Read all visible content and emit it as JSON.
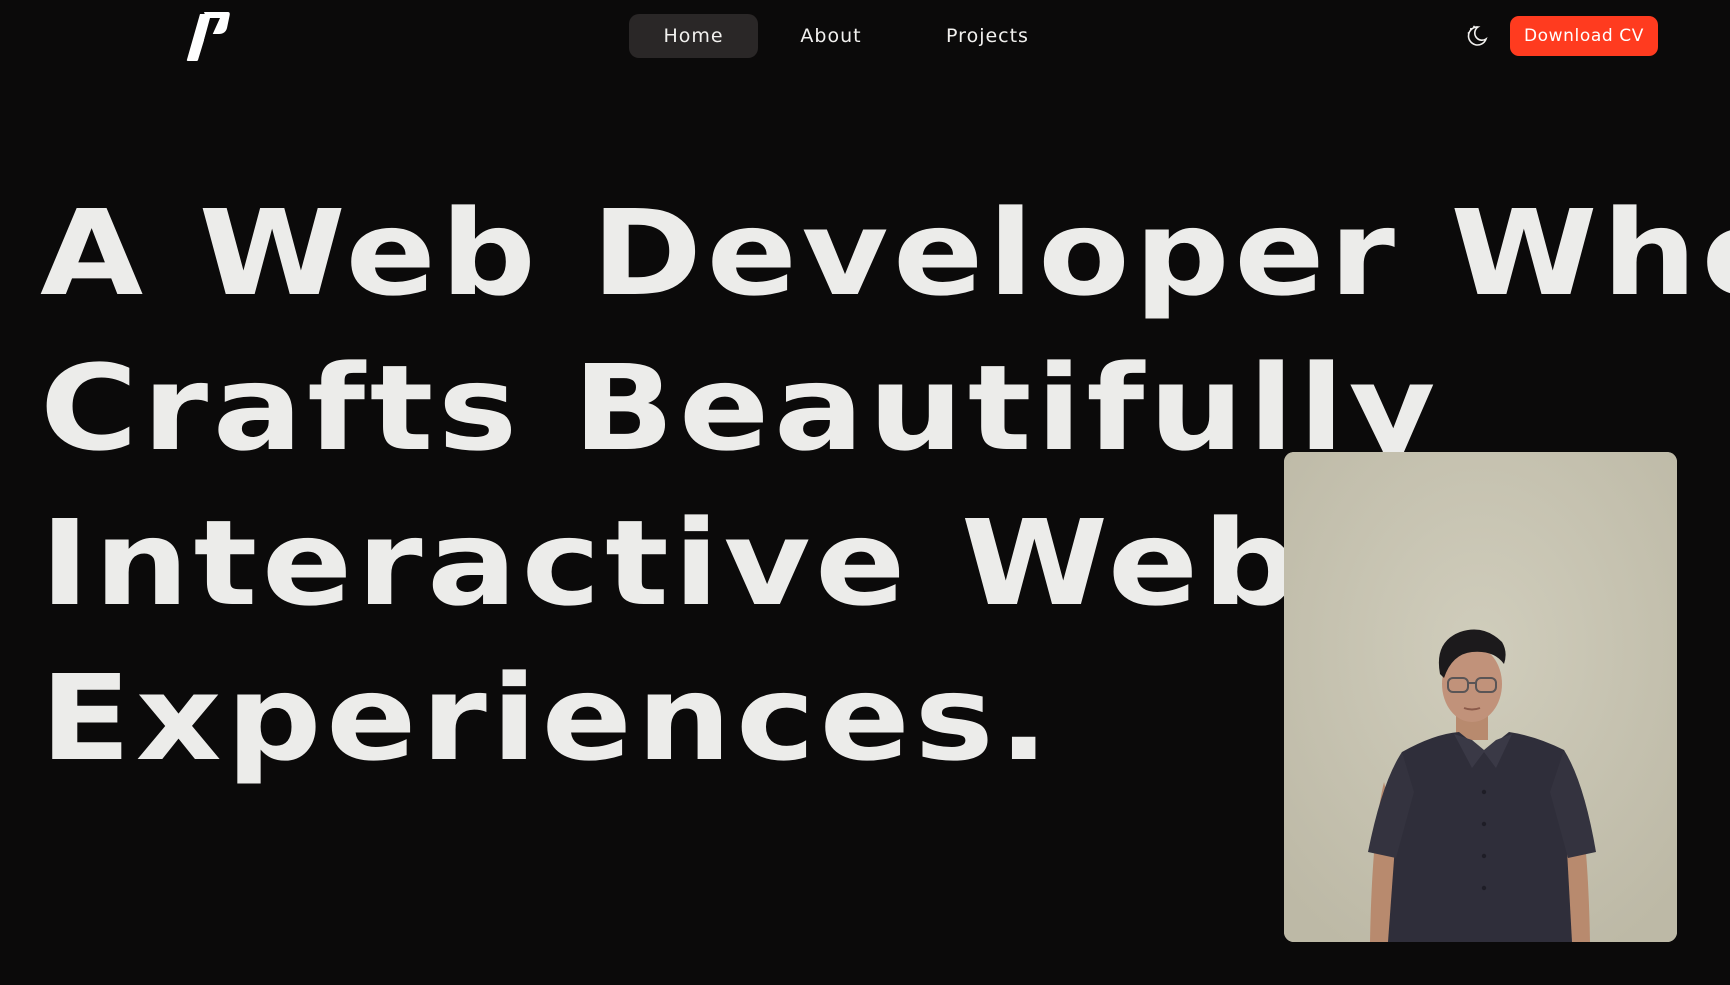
{
  "header": {
    "logo_icon": "p-monogram-logo",
    "nav": [
      {
        "label": "Home",
        "active": true
      },
      {
        "label": "About",
        "active": false
      },
      {
        "label": "Projects",
        "active": false
      }
    ],
    "theme_toggle_icon": "moon-icon",
    "cta_label": "Download CV"
  },
  "hero": {
    "lines": [
      "A Web Developer Who",
      "Crafts Beautifully",
      "Interactive Web",
      "Experiences."
    ]
  },
  "photo": {
    "subject": "portrait-photo"
  },
  "colors": {
    "background": "#0b0a0a",
    "text": "#ececea",
    "accent": "#ff3b1f",
    "nav_active_bg": "#2a2727"
  }
}
